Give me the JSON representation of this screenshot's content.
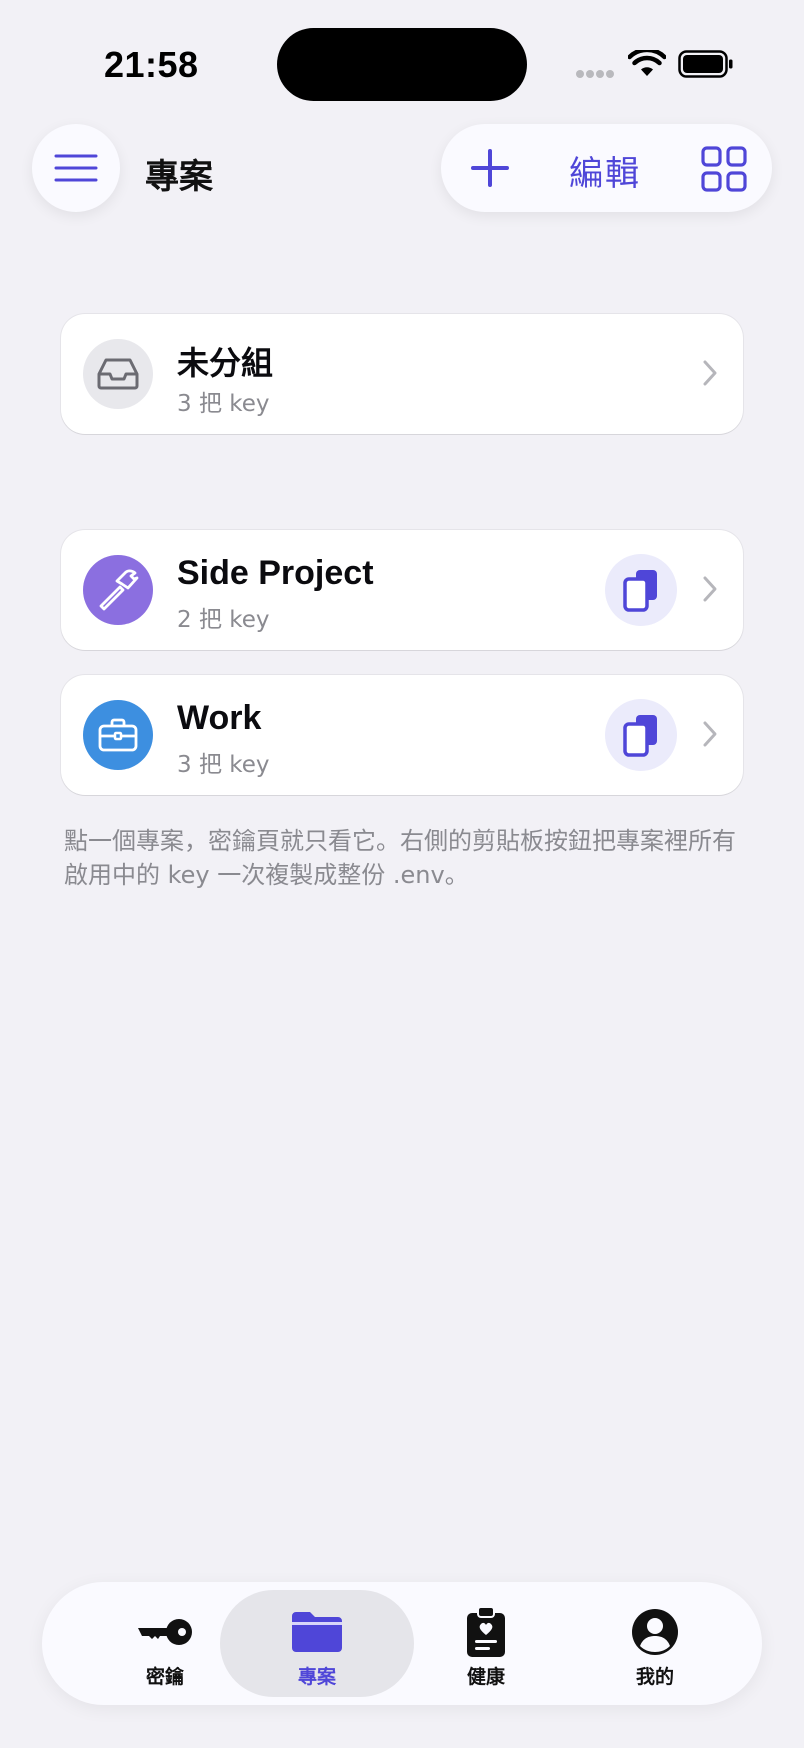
{
  "status_bar": {
    "time": "21:58"
  },
  "header": {
    "title": "專案",
    "edit_label": "編輯"
  },
  "ungrouped": {
    "name": "未分組",
    "count_label": "3 把 key"
  },
  "projects": [
    {
      "name": "Side Project",
      "count_label": "2 把 key",
      "color": "#8b6fe0",
      "icon": "hammer-icon"
    },
    {
      "name": "Work",
      "count_label": "3 把 key",
      "color": "#3d8fe0",
      "icon": "briefcase-icon"
    }
  ],
  "hint": "點一個專案，密鑰頁就只看它。右側的剪貼板按鈕把專案裡所有啟用中的 key 一次複製成整份 .env。",
  "tabs": [
    {
      "label": "密鑰",
      "icon": "key-icon"
    },
    {
      "label": "專案",
      "icon": "folder-icon",
      "active": true
    },
    {
      "label": "健康",
      "icon": "clipboard-health-icon"
    },
    {
      "label": "我的",
      "icon": "person-icon"
    }
  ],
  "colors": {
    "accent": "#4f46d8",
    "background": "#f2f1f6"
  }
}
